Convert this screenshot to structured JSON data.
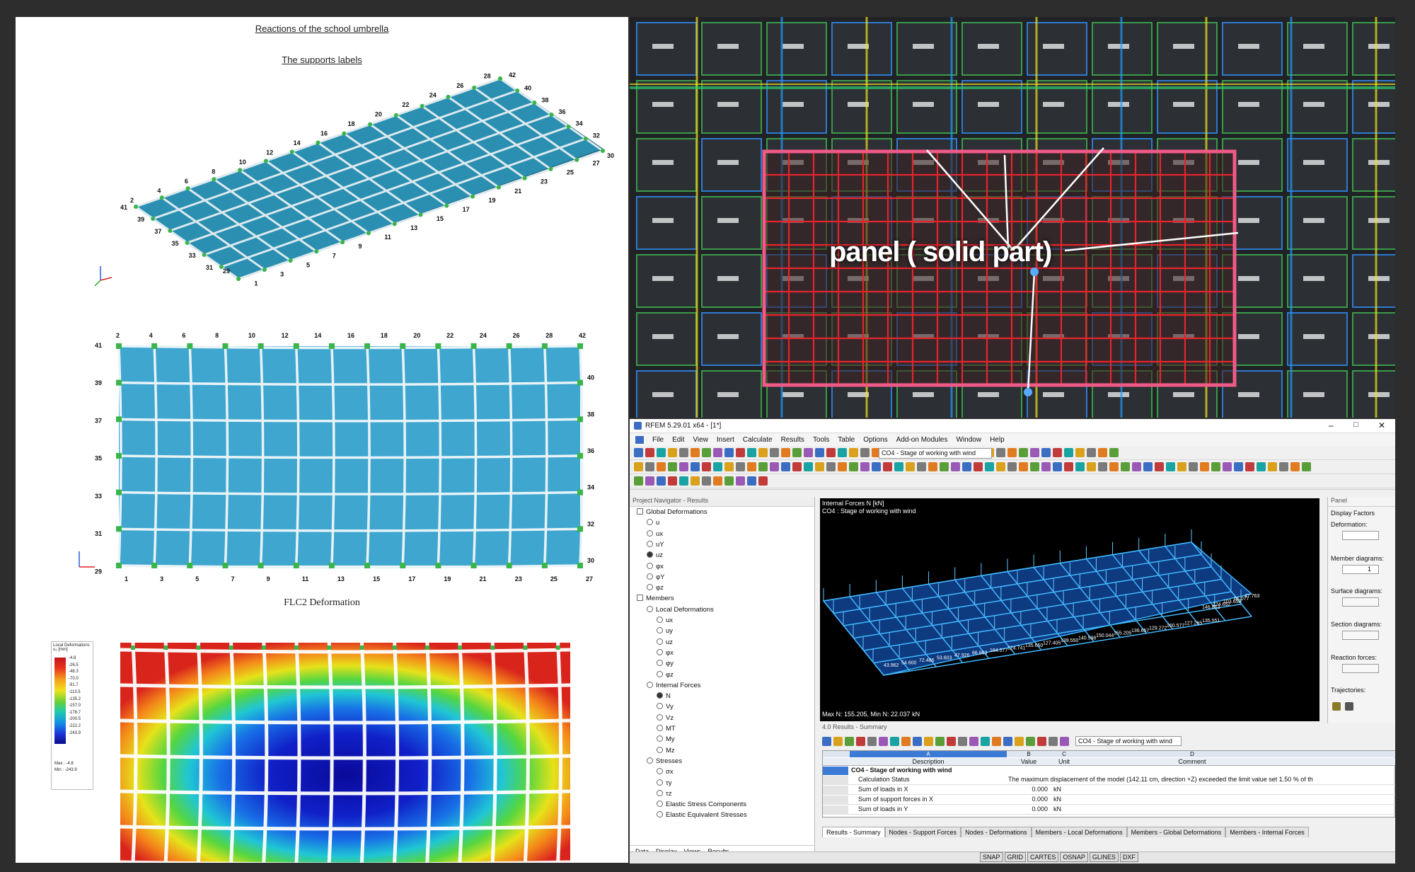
{
  "left_doc": {
    "title": "Reactions of the school umbrella",
    "subtitle": "The supports labels",
    "deformation_title": "FLC2 Deformation",
    "iso_labels": [
      "2",
      "4",
      "6",
      "8",
      "10",
      "12",
      "14",
      "16",
      "18",
      "20",
      "22",
      "24",
      "26",
      "28",
      "42",
      "40",
      "38",
      "36",
      "34",
      "32",
      "30",
      "27",
      "25",
      "23",
      "21",
      "19",
      "17",
      "15",
      "13",
      "11",
      "9",
      "7",
      "5",
      "3",
      "1",
      "29",
      "31",
      "33",
      "35",
      "37",
      "39",
      "41"
    ],
    "top_labels": [
      "2",
      "4",
      "6",
      "8",
      "10",
      "12",
      "14",
      "16",
      "18",
      "20",
      "22",
      "24",
      "26",
      "28",
      "42"
    ],
    "bottom_labels": [
      "1",
      "3",
      "5",
      "7",
      "9",
      "11",
      "13",
      "15",
      "17",
      "19",
      "21",
      "23",
      "25",
      "27"
    ],
    "left_labels": [
      "41",
      "39",
      "37",
      "35",
      "33",
      "31",
      "29"
    ],
    "right_labels": [
      "40",
      "38",
      "36",
      "34",
      "32",
      "30"
    ],
    "legend": {
      "header": "Local Deformations",
      "unit": "u₂ [mm]",
      "values": [
        "-4.8",
        "-26.5",
        "-48.3",
        "-70.0",
        "-91.7",
        "-113.5",
        "-135.2",
        "-157.0",
        "-178.7",
        "-200.5",
        "-222.2",
        "-243.9"
      ],
      "max_label": "Max :",
      "max_value": "-4.8",
      "min_label": "Min :",
      "min_value": "-243.9"
    }
  },
  "cad": {
    "annotation": "panel ( solid part)"
  },
  "rfem": {
    "window_title": "RFEM 5.29.01 x64 - [1*]",
    "window_controls": [
      "–",
      "□",
      "✕"
    ],
    "menu": [
      "File",
      "Edit",
      "View",
      "Insert",
      "Calculate",
      "Results",
      "Tools",
      "Table",
      "Options",
      "Add-on Modules",
      "Window",
      "Help"
    ],
    "load_case": "CO4 - Stage of working with wind",
    "navigator": {
      "title": "Project Navigator - Results",
      "items": [
        {
          "label": "Global Deformations",
          "level": 0
        },
        {
          "label": "u",
          "level": 1
        },
        {
          "label": "ux",
          "level": 1
        },
        {
          "label": "uY",
          "level": 1
        },
        {
          "label": "uz",
          "level": 1
        },
        {
          "label": "φx",
          "level": 1
        },
        {
          "label": "φY",
          "level": 1
        },
        {
          "label": "φz",
          "level": 1
        },
        {
          "label": "Members",
          "level": 0
        },
        {
          "label": "Local Deformations",
          "level": 1
        },
        {
          "label": "ux",
          "level": 2
        },
        {
          "label": "uy",
          "level": 2
        },
        {
          "label": "uz",
          "level": 2
        },
        {
          "label": "φx",
          "level": 2
        },
        {
          "label": "φy",
          "level": 2
        },
        {
          "label": "φz",
          "level": 2
        },
        {
          "label": "Internal Forces",
          "level": 1
        },
        {
          "label": "N",
          "level": 2
        },
        {
          "label": "Vy",
          "level": 2
        },
        {
          "label": "Vz",
          "level": 2
        },
        {
          "label": "MT",
          "level": 2
        },
        {
          "label": "My",
          "level": 2
        },
        {
          "label": "Mz",
          "level": 2
        },
        {
          "label": "Stresses",
          "level": 1
        },
        {
          "label": "σx",
          "level": 2
        },
        {
          "label": "τy",
          "level": 2
        },
        {
          "label": "τz",
          "level": 2
        },
        {
          "label": "Elastic Stress Components",
          "level": 2
        },
        {
          "label": "Elastic Equivalent Stresses",
          "level": 2
        }
      ],
      "bottom_tabs": [
        "Data",
        "Display",
        "Views",
        "Results"
      ]
    },
    "viewport": {
      "line1": "Internal Forces N [kN]",
      "line2": "CO4 : Stage of working with wind",
      "footer": "Max N: 155.205, Min N: 22.037 kN",
      "values": [
        "47.763",
        "66.077",
        "103.658",
        "124.652",
        "146.663",
        "135.551",
        "127.265",
        "160.577",
        "129.272",
        "136.657",
        "155.205",
        "150.044",
        "140.598",
        "139.550",
        "127.405",
        "135.650",
        "124.741",
        "184.577",
        "66.863",
        "47.926",
        "53.603",
        "72.486",
        "54.600",
        "43.962"
      ]
    },
    "panel": {
      "title": "Panel",
      "display_factors": "Display Factors",
      "deformation": "Deformation:",
      "member_diagrams": "Member diagrams:",
      "member_value": "1",
      "surface_diagrams": "Surface diagrams:",
      "section_diagrams": "Section diagrams:",
      "reaction_forces": "Reaction forces:",
      "trajectories": "Trajectories:"
    },
    "results": {
      "title": "4.0 Results - Summary",
      "col_letters": [
        "A",
        "B",
        "C",
        "D"
      ],
      "col_headers": [
        "Description",
        "Value",
        "Unit",
        "Comment"
      ],
      "group": "CO4 - Stage of working with wind",
      "rows": [
        {
          "desc": "Calculation Status",
          "value": "The maximum displacement of the model (142.11 cm, direction +Z) exceeded the limit value set 1.50 % of th",
          "unit": "",
          "comment": ""
        },
        {
          "desc": "Sum of loads in X",
          "value": "0.000",
          "unit": "kN",
          "comment": ""
        },
        {
          "desc": "Sum of support forces in X",
          "value": "0.000",
          "unit": "kN",
          "comment": ""
        },
        {
          "desc": "Sum of loads in Y",
          "value": "0.000",
          "unit": "kN",
          "comment": ""
        }
      ],
      "tabs": [
        "Results - Summary",
        "Nodes - Support Forces",
        "Nodes - Deformations",
        "Members - Local Deformations",
        "Members - Global Deformations",
        "Members - Internal Forces"
      ]
    },
    "status": [
      "SNAP",
      "GRID",
      "CARTES",
      "OSNAP",
      "GLINES",
      "DXF"
    ]
  }
}
